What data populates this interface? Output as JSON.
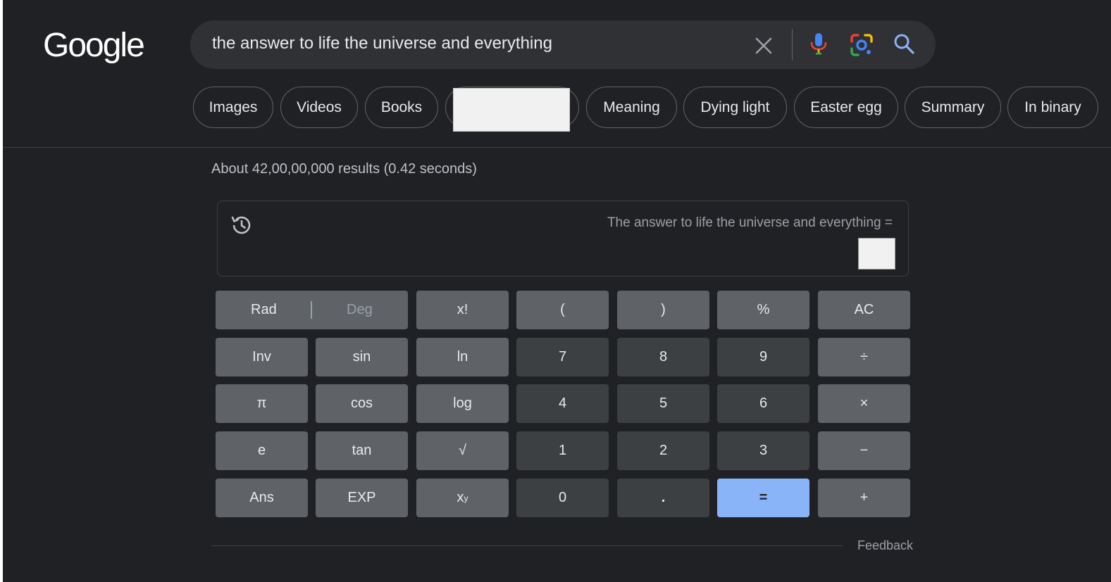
{
  "header": {
    "logo": "Google",
    "search": {
      "query": "the answer to life the universe and everything"
    },
    "icons": {
      "clear": "close-icon",
      "voice": "mic-icon",
      "lens": "lens-icon",
      "search": "search-icon"
    }
  },
  "chips": [
    "Images",
    "Videos",
    "Books",
    "",
    "Meaning",
    "Dying light",
    "Easter egg",
    "Summary",
    "In binary"
  ],
  "results_stats": "About 42,00,00,000 results (0.42 seconds)",
  "calculator": {
    "expression": "The answer to life the universe and everything =",
    "result": "",
    "history_icon": "history-icon",
    "mode": {
      "rad": "Rad",
      "deg": "Deg",
      "selected": "Rad"
    },
    "keys": {
      "factorial": "x!",
      "open_paren": "(",
      "close_paren": ")",
      "percent": "%",
      "clear": "AC",
      "inv": "Inv",
      "sin": "sin",
      "ln": "ln",
      "seven": "7",
      "eight": "8",
      "nine": "9",
      "divide": "÷",
      "pi": "π",
      "cos": "cos",
      "log": "log",
      "four": "4",
      "five": "5",
      "six": "6",
      "multiply": "×",
      "e": "e",
      "tan": "tan",
      "sqrt": "√",
      "one": "1",
      "two": "2",
      "three": "3",
      "minus": "−",
      "ans": "Ans",
      "exp": "EXP",
      "pow_base": "x",
      "pow_exp": "y",
      "zero": "0",
      "dot": ".",
      "equals": "=",
      "plus": "+"
    }
  },
  "feedback": "Feedback",
  "colors": {
    "background": "#202124",
    "key_function": "#5f6368",
    "key_number": "#3c4043",
    "key_equals": "#8ab4f8"
  }
}
